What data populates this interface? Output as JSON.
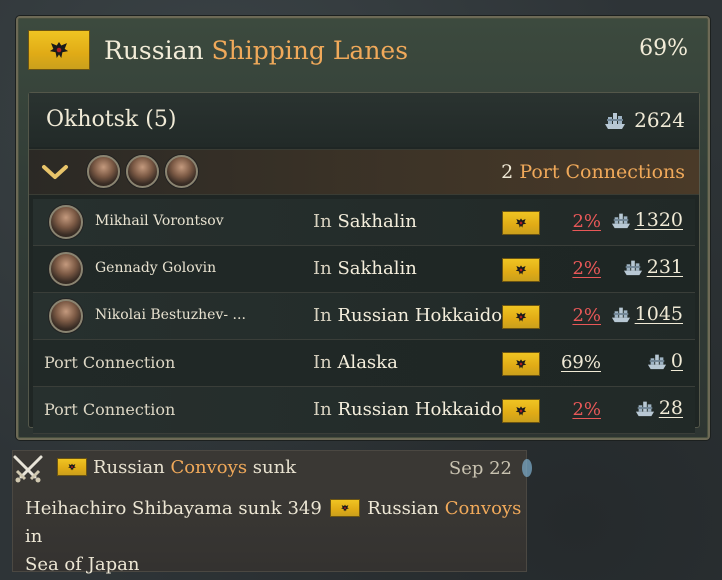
{
  "header": {
    "title_prefix": "Russian",
    "title_accent": "Shipping Lanes",
    "percent": "69%",
    "flag_icon": "russian-eagle-flag"
  },
  "region": {
    "name": "Okhotsk (5)",
    "ship_count": "2624",
    "ship_icon": "ship-icon"
  },
  "connections": {
    "count": "2",
    "label": "Port Connections",
    "toggle_icon": "chevron-down-icon",
    "admiral_portraits": 3
  },
  "rows": [
    {
      "name": "Mikhail Vorontsov",
      "in": "In",
      "place": "Sakhalin",
      "percent": "2%",
      "percent_color": "red",
      "ships": "1320",
      "has_portrait": true
    },
    {
      "name": "Gennady Golovin",
      "in": "In",
      "place": "Sakhalin",
      "percent": "2%",
      "percent_color": "red",
      "ships": "231",
      "has_portrait": true
    },
    {
      "name": "Nikolai Bestuzhev- ...",
      "in": "In",
      "place": "Russian Hokkaido",
      "percent": "2%",
      "percent_color": "red",
      "ships": "1045",
      "has_portrait": true
    },
    {
      "name": "Port Connection",
      "in": "In",
      "place": "Alaska",
      "percent": "69%",
      "percent_color": "white",
      "ships": "0",
      "has_portrait": false
    },
    {
      "name": "Port Connection",
      "in": "In",
      "place": "Russian Hokkaido",
      "percent": "2%",
      "percent_color": "red",
      "ships": "28",
      "has_portrait": false
    }
  ],
  "notification": {
    "icon": "crossed-swords-icon",
    "title_prefix": "Russian",
    "title_accent": "Convoys",
    "title_suffix": "sunk",
    "date": "Sep 22",
    "body_part1": "Heihachiro Shibayama sunk",
    "body_number": "349",
    "body_prefix": "Russian",
    "body_accent": "Convoys",
    "body_suffix": "in",
    "body_line2": "Sea of Japan"
  },
  "colors": {
    "accent": "#f0a95a",
    "negative": "#e85858",
    "flag_gold": "#e8b81c"
  }
}
